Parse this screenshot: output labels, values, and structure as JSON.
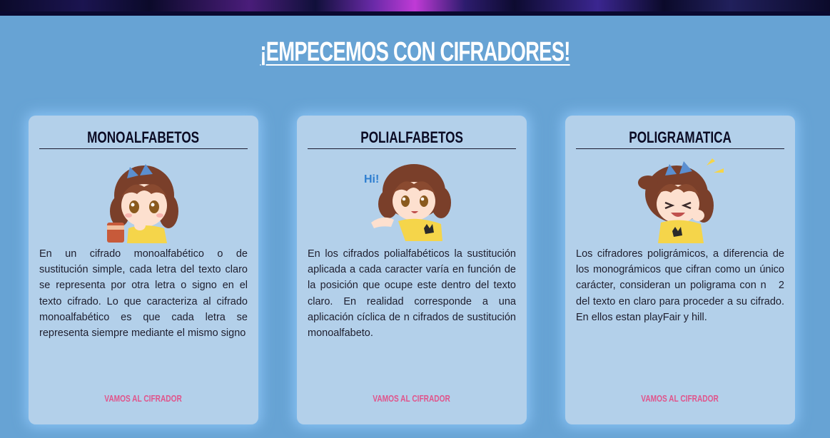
{
  "page": {
    "title": "¡EMPECEMOS CON CIFRADORES!"
  },
  "cards": [
    {
      "title": "MONOALFABETOS",
      "illustration": "chibi-girl-drinking",
      "body": "En un cifrado monoalfabético o de sustitución simple, cada letra del texto claro se representa por otra letra o signo en el texto cifrado. Lo que caracteriza al cifrado monoalfabético es que cada letra se representa siempre mediante el mismo signo",
      "link_label": "VAMOS AL CIFRADOR"
    },
    {
      "title": "POLIALFABETOS",
      "illustration": "chibi-girl-waving",
      "illustration_text": "Hi!",
      "body": "En los cifrados polialfabéticos la sustitución aplicada a cada caracter varía en función de la posición que ocupe este dentro del texto claro. En realidad corresponde a una aplicación cíclica de n cifrados de sustitución monoalfabeto.",
      "link_label": "VAMOS AL CIFRADOR"
    },
    {
      "title": "POLIGRAMATICA",
      "illustration": "chibi-girl-laughing",
      "body": "Los cifradores poligrámicos, a diferencia de los monográmicos que cifran como un único carácter, consideran un poligrama con n   2 del texto en claro para proceder a su cifrado. En ellos estan playFair y hill.",
      "link_label": "VAMOS AL CIFRADOR"
    }
  ],
  "colors": {
    "background": "#67a3d4",
    "card": "#b3d0ea",
    "link": "#e0558c",
    "title": "#ffffff",
    "heading": "#0b0b24"
  }
}
